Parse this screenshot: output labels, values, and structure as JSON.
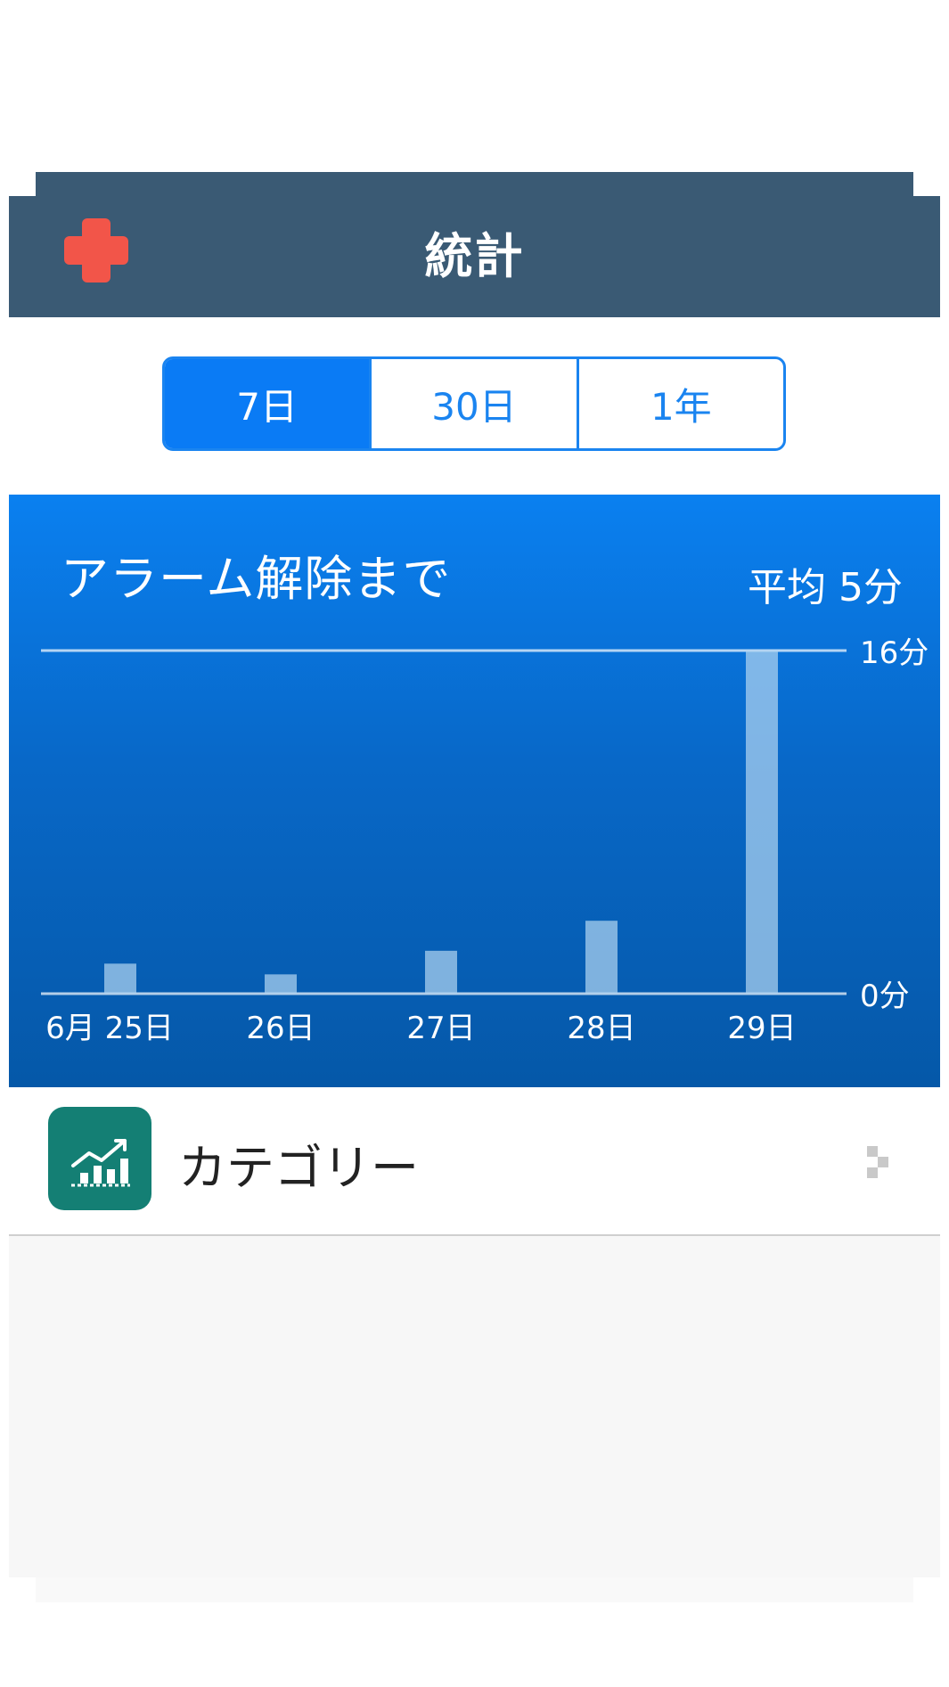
{
  "nav": {
    "title": "統計",
    "add_icon": "plus-icon"
  },
  "tabs": [
    {
      "label": "7日",
      "active": true
    },
    {
      "label": "30日",
      "active": false
    },
    {
      "label": "1年",
      "active": false
    }
  ],
  "chart": {
    "title": "アラーム解除まで",
    "average": "平均 5分",
    "y_max_label": "16分",
    "y_min_label": "0分"
  },
  "chart_data": {
    "type": "bar",
    "categories": [
      "6月 25日",
      "26日",
      "27日",
      "28日",
      "29日"
    ],
    "values": [
      1.4,
      0.9,
      2.0,
      3.4,
      16
    ],
    "ylim": [
      0,
      16
    ],
    "ylabel_ticks": [
      "0分",
      "16分"
    ],
    "grid": true
  },
  "colors": {
    "nav_bg": "#3a5a74",
    "accent": "#0a7bf5",
    "add_button": "#f25549",
    "category_icon_bg": "#147f74"
  },
  "category": {
    "label": "カテゴリー",
    "icon": "chart-up-icon",
    "chevron": "chevron-right-icon"
  }
}
